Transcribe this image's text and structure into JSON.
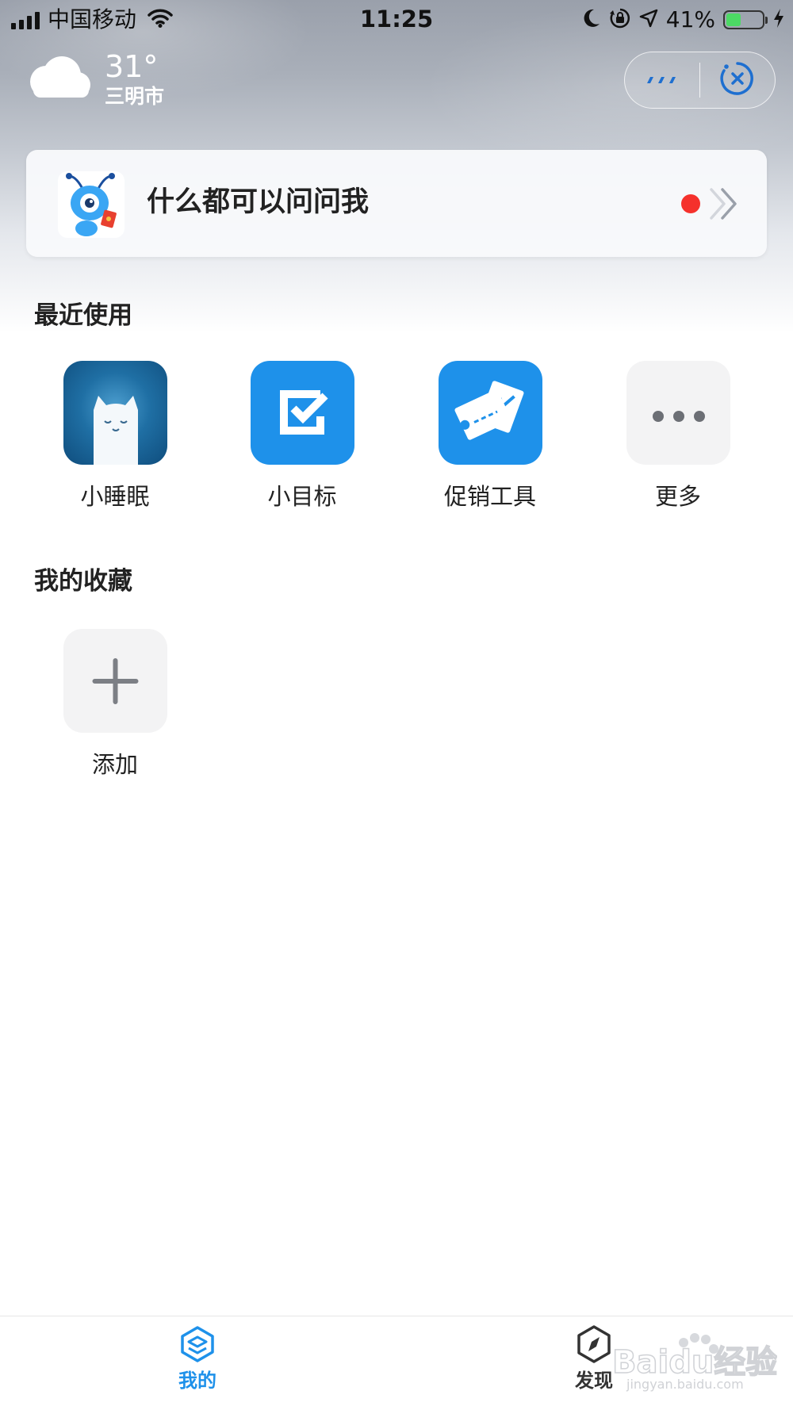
{
  "status_bar": {
    "carrier": "中国移动",
    "time": "11:25",
    "battery_percent": "41%",
    "battery_level": 0.41,
    "icons": [
      "signal-icon",
      "wifi-icon",
      "moon-icon",
      "rotation-lock-icon",
      "location-icon",
      "battery-icon",
      "charging-icon"
    ]
  },
  "weather": {
    "temperature": "31°",
    "city": "三明市",
    "icon": "cloud-icon"
  },
  "capsule": {
    "icons": [
      "more-icon",
      "close-mini-program-icon"
    ]
  },
  "search": {
    "prompt": "什么都可以问问我",
    "icon": "ant-mascot-icon"
  },
  "recent": {
    "title": "最近使用",
    "apps": [
      {
        "label": "小睡眠",
        "icon": "sleep-cat-icon"
      },
      {
        "label": "小目标",
        "icon": "checkbox-icon"
      },
      {
        "label": "促销工具",
        "icon": "ticket-icon"
      },
      {
        "label": "更多",
        "icon": "more-dots-icon"
      }
    ]
  },
  "favorites": {
    "title": "我的收藏",
    "add_label": "添加",
    "icon": "plus-icon"
  },
  "tabs": [
    {
      "label": "我的",
      "icon": "cube-icon",
      "active": true
    },
    {
      "label": "发现",
      "icon": "compass-icon",
      "active": false
    }
  ],
  "colors": {
    "accent": "#1e91ea",
    "red_dot": "#f5312c",
    "battery_fill": "#4cd964"
  }
}
